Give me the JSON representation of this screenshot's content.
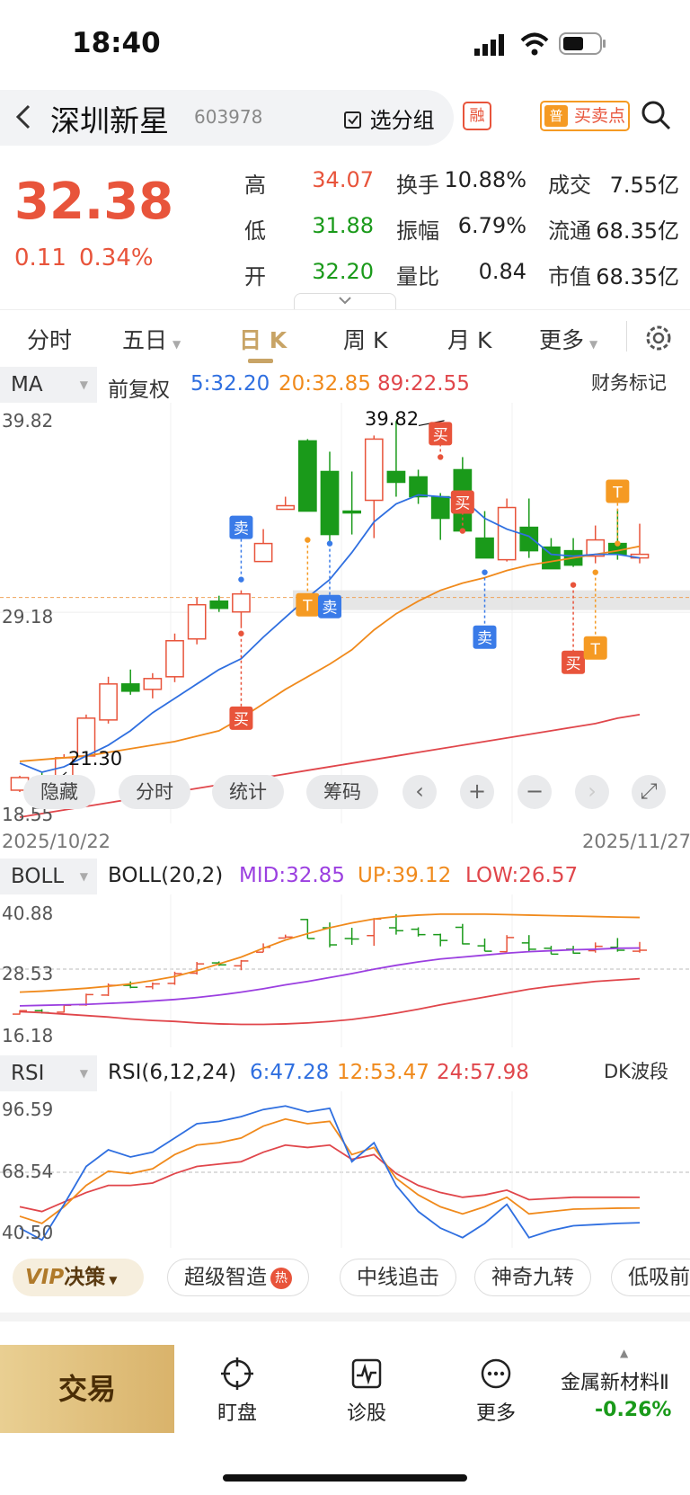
{
  "status_bar": {
    "time": "18:40"
  },
  "header": {
    "back_icon": "chevron-left-icon",
    "stock_name": "深圳新星",
    "stock_code": "603978",
    "group_button": "选分组",
    "margin_badge": "融",
    "buy_sell_points_button": "买卖点",
    "buy_sell_icon_text": "普"
  },
  "quote": {
    "price": "32.38",
    "change": "0.11",
    "change_pct": "0.34%",
    "labels": {
      "high": "高",
      "low": "低",
      "open": "开",
      "turnover_rate": "换手",
      "amplitude": "振幅",
      "volume_ratio": "量比",
      "volume": "成交",
      "float_cap": "流通",
      "market_cap": "市值"
    },
    "high": "34.07",
    "low": "31.88",
    "open": "32.20",
    "turnover_rate": "10.88%",
    "amplitude": "6.79%",
    "volume_ratio": "0.84",
    "volume": "7.55亿",
    "float_cap": "68.35亿",
    "market_cap": "68.35亿",
    "colors": {
      "up": "#e8543b",
      "down": "#1a9a1a"
    }
  },
  "tabs": {
    "items": [
      "分时",
      "五日",
      "日 K",
      "周 K",
      "月 K",
      "更多"
    ],
    "active": "日 K"
  },
  "main_panel": {
    "indicator": "MA",
    "adjust": "前复权",
    "ma5": "5:32.20",
    "ma20": "20:32.85",
    "ma89": "89:22.55",
    "finance_marker_button": "财务标记",
    "y_top": "39.82",
    "y_mid": "29.18",
    "y_bottom": "18.55",
    "date_start": "2025/10/22",
    "date_end": "2025/11/27",
    "high_label": "39.82",
    "low_label": "21.30",
    "signals": {
      "buy": "买",
      "sell": "卖",
      "t": "T"
    }
  },
  "toolbar": {
    "hide": "隐藏",
    "intraday": "分时",
    "stats": "统计",
    "chips": "筹码"
  },
  "boll_panel": {
    "indicator": "BOLL",
    "params": "BOLL(20,2)",
    "mid": "MID:32.85",
    "up": "UP:39.12",
    "low": "LOW:26.57",
    "y_top": "40.88",
    "y_mid": "28.53",
    "y_bottom": "16.18"
  },
  "rsi_panel": {
    "indicator": "RSI",
    "params": "RSI(6,12,24)",
    "rsi6": "6:47.28",
    "rsi12": "12:53.47",
    "rsi24": "24:57.98",
    "dk_button": "DK波段",
    "y_top": "96.59",
    "y_mid": "68.54",
    "y_bottom": "40.50"
  },
  "strategy_bar": {
    "vip": "决策",
    "vip_prefix": "VIP",
    "chips": [
      "超级智造",
      "中线追击",
      "神奇九转",
      "低吸前"
    ],
    "hot": "热"
  },
  "bottom_nav": {
    "trade": "交易",
    "watch": "盯盘",
    "diagnose": "诊股",
    "more": "更多",
    "sector_name": "金属新材料Ⅱ",
    "sector_change": "-0.26%"
  },
  "chart_data": {
    "type": "candlestick",
    "ohlc": [
      [
        19.3,
        20.1,
        19.2,
        20.0
      ],
      [
        20.0,
        20.3,
        19.4,
        19.6
      ],
      [
        19.7,
        21.3,
        19.6,
        21.1
      ],
      [
        21.2,
        23.5,
        21.0,
        23.3
      ],
      [
        23.2,
        25.6,
        23.0,
        25.2
      ],
      [
        25.2,
        26.0,
        24.6,
        24.8
      ],
      [
        24.9,
        25.8,
        24.4,
        25.5
      ],
      [
        25.6,
        28.0,
        25.3,
        27.6
      ],
      [
        27.7,
        30.0,
        27.4,
        29.6
      ],
      [
        29.8,
        30.1,
        29.2,
        29.4
      ],
      [
        29.2,
        30.4,
        28.3,
        30.2
      ],
      [
        32.0,
        33.8,
        32.0,
        33.0
      ],
      [
        34.9,
        35.6,
        34.9,
        35.1
      ],
      [
        38.7,
        38.8,
        34.8,
        34.8
      ],
      [
        37.0,
        38.1,
        33.0,
        33.5
      ],
      [
        34.8,
        37.0,
        33.5,
        34.7
      ],
      [
        35.4,
        39.0,
        33.3,
        38.8
      ],
      [
        37.0,
        39.8,
        35.6,
        36.4
      ],
      [
        36.7,
        37.1,
        35.2,
        35.6
      ],
      [
        35.6,
        35.8,
        33.2,
        34.4
      ],
      [
        37.1,
        37.8,
        33.6,
        33.7
      ],
      [
        33.3,
        34.8,
        32.2,
        32.2
      ],
      [
        32.1,
        35.5,
        32.0,
        35.0
      ],
      [
        33.9,
        35.5,
        32.2,
        32.6
      ],
      [
        32.8,
        33.3,
        31.6,
        31.6
      ],
      [
        32.6,
        33.3,
        31.7,
        31.8
      ],
      [
        32.3,
        34.0,
        31.9,
        33.2
      ],
      [
        33.0,
        34.9,
        32.1,
        32.4
      ],
      [
        32.2,
        34.1,
        31.9,
        32.4
      ]
    ],
    "ma5": [
      20.8,
      20.3,
      20.6,
      21.2,
      21.8,
      22.6,
      23.6,
      24.4,
      25.2,
      26.0,
      26.6,
      27.8,
      28.9,
      30.0,
      31.0,
      32.5,
      34.2,
      35.2,
      35.7,
      35.6,
      35.5,
      34.4,
      33.8,
      33.4,
      32.4,
      32.3,
      32.4,
      32.4,
      32.2
    ],
    "ma20": [
      20.9,
      21.0,
      21.1,
      21.2,
      21.4,
      21.6,
      21.8,
      22.0,
      22.3,
      22.6,
      23.3,
      24.1,
      24.9,
      25.6,
      26.3,
      27.1,
      28.2,
      29.1,
      29.8,
      30.4,
      30.8,
      31.1,
      31.5,
      31.8,
      32.0,
      32.2,
      32.4,
      32.6,
      32.85
    ],
    "ma89": [
      17.8,
      18.0,
      18.2,
      18.4,
      18.6,
      18.8,
      19.0,
      19.2,
      19.4,
      19.6,
      19.8,
      20.0,
      20.2,
      20.4,
      20.6,
      20.8,
      21.0,
      21.2,
      21.4,
      21.6,
      21.8,
      22.0,
      22.2,
      22.4,
      22.6,
      22.8,
      23.0,
      23.3,
      23.5
    ],
    "y_range": [
      18.55,
      39.82
    ],
    "boll_range": [
      16.18,
      40.88
    ],
    "boll_mid": [
      21.0,
      21.1,
      21.2,
      21.3,
      21.5,
      21.7,
      22.0,
      22.3,
      22.7,
      23.2,
      23.8,
      24.5,
      25.3,
      26.0,
      26.8,
      27.6,
      28.5,
      29.3,
      30.0,
      30.6,
      31.0,
      31.4,
      31.8,
      32.1,
      32.3,
      32.5,
      32.6,
      32.8,
      32.85
    ],
    "boll_up": [
      23.8,
      24.0,
      24.3,
      24.6,
      25.0,
      25.5,
      26.2,
      27.0,
      28.2,
      29.6,
      31.0,
      32.8,
      34.5,
      35.8,
      37.0,
      38.0,
      38.8,
      39.3,
      39.6,
      39.8,
      39.8,
      39.8,
      39.7,
      39.6,
      39.5,
      39.4,
      39.3,
      39.2,
      39.12
    ],
    "boll_low": [
      19.8,
      19.6,
      19.3,
      19.0,
      18.7,
      18.3,
      18.0,
      17.8,
      17.5,
      17.3,
      17.2,
      17.2,
      17.3,
      17.5,
      17.8,
      18.2,
      18.8,
      19.5,
      20.3,
      21.2,
      22.0,
      22.8,
      23.6,
      24.4,
      25.0,
      25.5,
      26.0,
      26.3,
      26.57
    ],
    "rsi_range": [
      40.5,
      96.59
    ],
    "rsi6": [
      45.0,
      40.0,
      55.0,
      71.0,
      78.0,
      75.0,
      77.0,
      83.0,
      89.0,
      90.0,
      92.0,
      95.0,
      96.5,
      94.0,
      95.5,
      73.0,
      81.0,
      63.0,
      52.0,
      45.0,
      41.0,
      47.0,
      55.0,
      41.0,
      44.0,
      46.0,
      46.5,
      47.0,
      47.28
    ],
    "rsi12": [
      50.0,
      47.0,
      54.0,
      63.0,
      69.0,
      68.0,
      70.0,
      76.0,
      80.0,
      81.0,
      83.0,
      88.0,
      91.0,
      89.0,
      90.0,
      76.0,
      79.0,
      66.0,
      59.0,
      54.0,
      51.0,
      54.0,
      58.0,
      51.0,
      52.0,
      53.0,
      53.2,
      53.4,
      53.47
    ],
    "rsi24": [
      54.0,
      52.0,
      56.0,
      60.0,
      63.0,
      63.0,
      64.0,
      68.0,
      71.0,
      72.0,
      73.0,
      77.0,
      80.0,
      79.0,
      80.0,
      74.0,
      76.0,
      68.0,
      63.0,
      60.0,
      58.0,
      59.0,
      61.0,
      57.0,
      57.5,
      58.0,
      58.0,
      58.0,
      57.98
    ]
  }
}
